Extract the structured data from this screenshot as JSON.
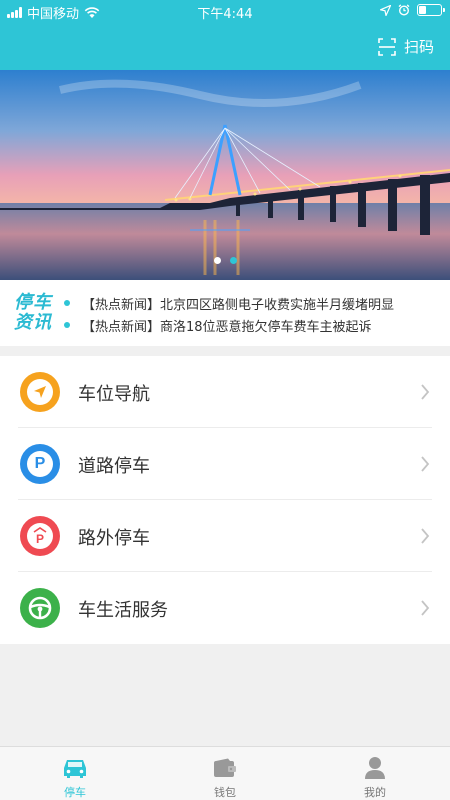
{
  "status_bar": {
    "carrier": "中国移动",
    "time": "下午4:44"
  },
  "header": {
    "scan_label": "扫码"
  },
  "banner": {
    "slide_count": 2,
    "active_slide": 2
  },
  "news": {
    "logo_line1": "停车",
    "logo_line2": "资讯",
    "items": [
      {
        "text": "【热点新闻】北京四区路侧电子收费实施半月缓堵明显"
      },
      {
        "text": "【热点新闻】商洛18位恶意拖欠停车费车主被起诉"
      }
    ]
  },
  "menu": {
    "items": [
      {
        "label": "车位导航",
        "icon": "navigation-icon",
        "color": "#f6a21e"
      },
      {
        "label": "道路停车",
        "icon": "parking-icon",
        "color": "#2a8ee6"
      },
      {
        "label": "路外停车",
        "icon": "offstreet-parking-icon",
        "color": "#ef4a52"
      },
      {
        "label": "车生活服务",
        "icon": "steering-wheel-icon",
        "color": "#3cb14a"
      }
    ]
  },
  "tabbar": {
    "items": [
      {
        "label": "停车",
        "icon": "car-icon",
        "active": true
      },
      {
        "label": "钱包",
        "icon": "wallet-icon",
        "active": false
      },
      {
        "label": "我的",
        "icon": "user-icon",
        "active": false
      }
    ]
  },
  "colors": {
    "accent": "#2ec5d6",
    "background": "#f0f0f0"
  }
}
